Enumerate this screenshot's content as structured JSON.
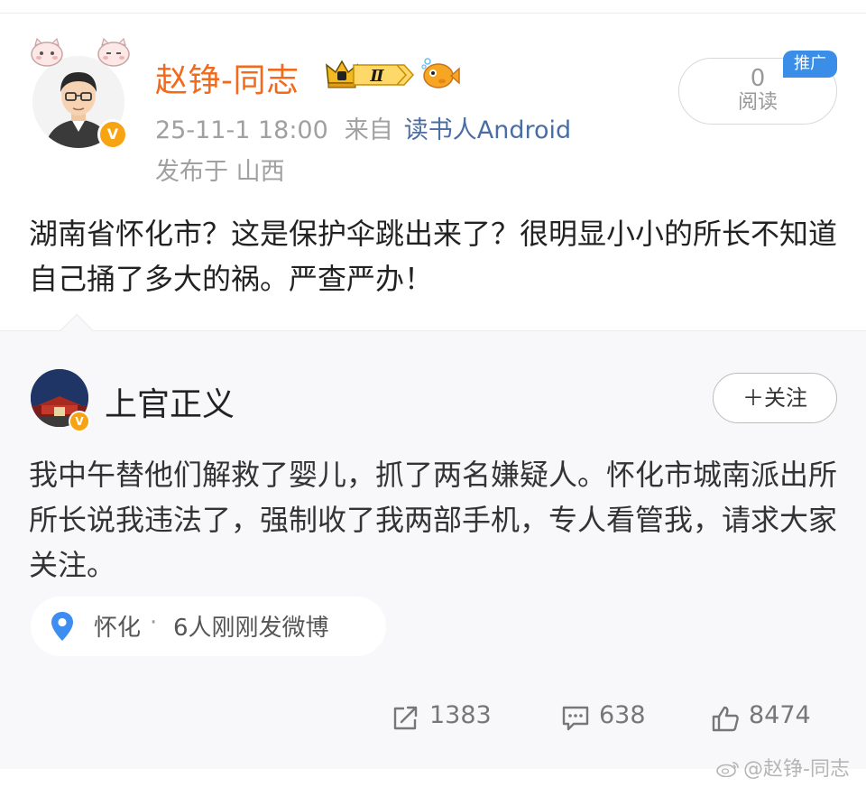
{
  "post": {
    "author": "赵铮-同志",
    "level": "Ⅱ",
    "time": "25-11-1 18:00",
    "from_label": "来自",
    "source": "读书人Android",
    "location": "发布于 山西",
    "read_count": "0",
    "read_label": "阅读",
    "promo": "推广",
    "text": "湖南省怀化市？这是保护伞跳出来了？很明显小小的所长不知道自己捅了多大的祸。严查严办！"
  },
  "repost": {
    "author": "上官正义",
    "follow_label": "＋关注",
    "text": "我中午替他们解救了婴儿，抓了两名嫌疑人。怀化市城南派出所所长说我违法了，强制收了我两部手机，专人看管我，请求大家关注。",
    "location_chip": {
      "city": "怀化",
      "separator": "·",
      "people": "6人刚刚发微博"
    },
    "stats": {
      "reposts": "1383",
      "comments": "638",
      "likes": "8474"
    }
  },
  "watermark": "@赵铮-同志",
  "icons": {
    "verified": "verified-v-badge-icon",
    "level": "crown-level-badge-icon",
    "fish": "fish-emoji-icon",
    "location": "location-pin-icon",
    "repost": "repost-icon",
    "comment": "comment-icon",
    "like": "thumbs-up-icon"
  },
  "colors": {
    "username_orange": "#f26a1b",
    "source_link": "#4a6ea4",
    "meta_gray": "#a0a0a0",
    "promo_blue": "#3b8ee8",
    "verified_gold": "#f8a412",
    "location_blue": "#3d8ef0",
    "card_bg": "#f8f7fa"
  }
}
